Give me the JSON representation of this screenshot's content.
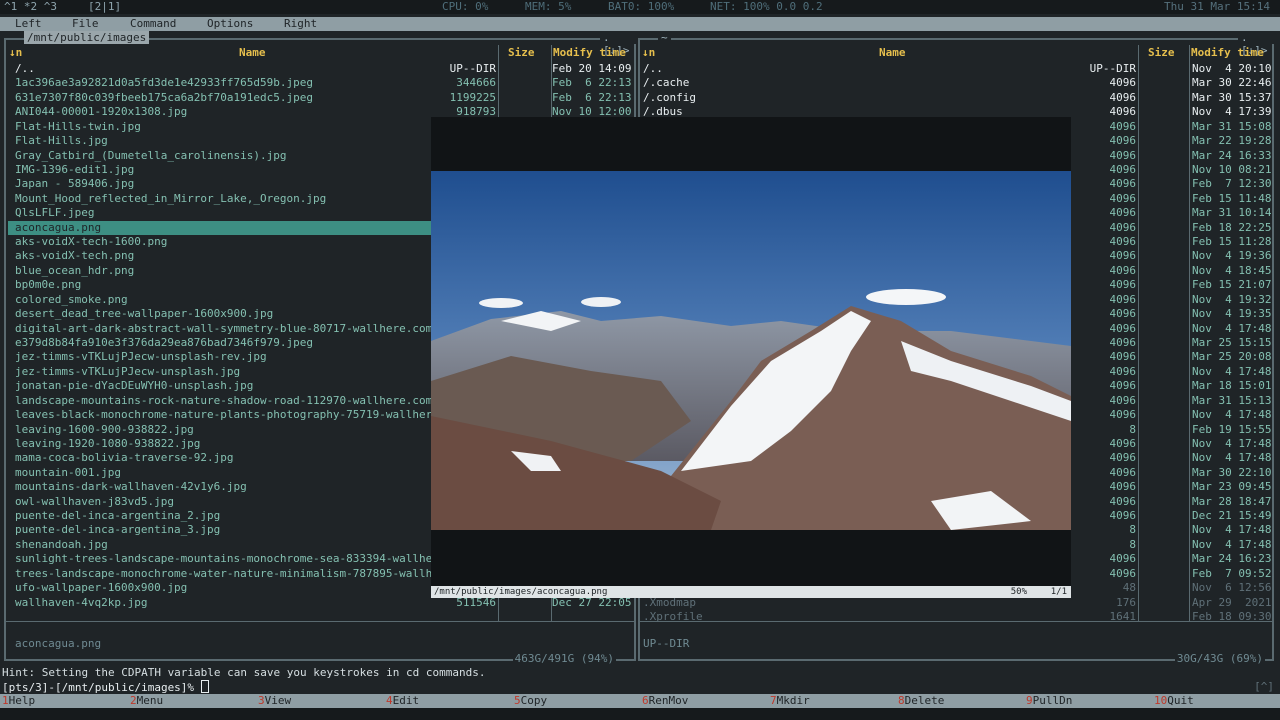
{
  "statusbar": {
    "workspaces": "^1 *2 ^3",
    "layout": "[2|1]",
    "cpu": "CPU:  0%",
    "mem": "MEM:  5%",
    "bat": "BAT0:  100%",
    "net": "NET:  100%  0.0  0.2",
    "clock": "Thu 31 Mar 15:14"
  },
  "menu": [
    "Left",
    "File",
    "Command",
    "Options",
    "Right"
  ],
  "left": {
    "path": "/mnt/public/images",
    "sort_indicator": ".[↓]>",
    "header": {
      "sort": "↓n",
      "name": "Name",
      "size": "Size",
      "mtime": "Modify time"
    },
    "rows": [
      {
        "n": "/..",
        "s": "UP--DIR",
        "t": "Feb 20 14:09",
        "type": "dir"
      },
      {
        "n": "1ac396ae3a92821d0a5fd3de1e42933ff765d59b.jpeg",
        "s": "344666",
        "t": "Feb  6 22:13"
      },
      {
        "n": "631e7307f80c039fbeeb175ca6a2bf70a191edc5.jpeg",
        "s": "1199225",
        "t": "Feb  6 22:13"
      },
      {
        "n": "ANI044-00001-1920x1308.jpg",
        "s": "918793",
        "t": "Nov 10 12:00"
      },
      {
        "n": "Flat-Hills-twin.jpg",
        "s": "",
        "t": ""
      },
      {
        "n": "Flat-Hills.jpg",
        "s": "",
        "t": ""
      },
      {
        "n": "Gray_Catbird_(Dumetella_carolinensis).jpg",
        "s": "",
        "t": ""
      },
      {
        "n": "IMG-1396-edit1.jpg",
        "s": "",
        "t": ""
      },
      {
        "n": "Japan - 589406.jpg",
        "s": "",
        "t": ""
      },
      {
        "n": "Mount_Hood_reflected_in_Mirror_Lake,_Oregon.jpg",
        "s": "",
        "t": ""
      },
      {
        "n": "QlsLFLF.jpeg",
        "s": "",
        "t": ""
      },
      {
        "n": "aconcagua.png",
        "s": "",
        "t": "",
        "selected": true
      },
      {
        "n": "aks-voidX-tech-1600.png",
        "s": "",
        "t": ""
      },
      {
        "n": "aks-voidX-tech.png",
        "s": "",
        "t": ""
      },
      {
        "n": "blue_ocean_hdr.png",
        "s": "",
        "t": ""
      },
      {
        "n": "bp0m0e.png",
        "s": "",
        "t": ""
      },
      {
        "n": "colored_smoke.png",
        "s": "",
        "t": ""
      },
      {
        "n": "desert_dead_tree-wallpaper-1600x900.jpg",
        "s": "",
        "t": ""
      },
      {
        "n": "digital-art-dark-abstract-wall-symmetry-blue-80717-wallhere.com.j",
        "s": "",
        "t": ""
      },
      {
        "n": "e379d8b84fa910e3f376da29ea876bad7346f979.jpeg",
        "s": "",
        "t": ""
      },
      {
        "n": "jez-timms-vTKLujPJecw-unsplash-rev.jpg",
        "s": "",
        "t": ""
      },
      {
        "n": "jez-timms-vTKLujPJecw-unsplash.jpg",
        "s": "",
        "t": ""
      },
      {
        "n": "jonatan-pie-dYacDEuWYH0-unsplash.jpg",
        "s": "",
        "t": ""
      },
      {
        "n": "landscape-mountains-rock-nature-shadow-road-112970-wallhere.com(1",
        "s": "",
        "t": ""
      },
      {
        "n": "leaves-black-monochrome-nature-plants-photography-75719-wallhere.",
        "s": "",
        "t": ""
      },
      {
        "n": "leaving-1600-900-938822.jpg",
        "s": "",
        "t": ""
      },
      {
        "n": "leaving-1920-1080-938822.jpg",
        "s": "",
        "t": ""
      },
      {
        "n": "mama-coca-bolivia-traverse-92.jpg",
        "s": "",
        "t": ""
      },
      {
        "n": "mountain-001.jpg",
        "s": "",
        "t": ""
      },
      {
        "n": "mountains-dark-wallhaven-42v1y6.jpg",
        "s": "",
        "t": ""
      },
      {
        "n": "owl-wallhaven-j83vd5.jpg",
        "s": "",
        "t": ""
      },
      {
        "n": "puente-del-inca-argentina_2.jpg",
        "s": "",
        "t": ""
      },
      {
        "n": "puente-del-inca-argentina_3.jpg",
        "s": "",
        "t": ""
      },
      {
        "n": "shenandoah.jpg",
        "s": "",
        "t": ""
      },
      {
        "n": "sunlight-trees-landscape-mountains-monochrome-sea-833394-wallhere",
        "s": "",
        "t": ""
      },
      {
        "n": "trees-landscape-monochrome-water-nature-minimalism-787895-wallher",
        "s": "",
        "t": ""
      },
      {
        "n": "ufo-wallpaper-1600x900.jpg",
        "s": "",
        "t": ""
      },
      {
        "n": "wallhaven-4vq2kp.jpg",
        "s": "511546",
        "t": "Dec 27 22:05"
      }
    ],
    "mini_status": "aconcagua.png",
    "disk": "463G/491G (94%)"
  },
  "right": {
    "path": "~",
    "sort_indicator": ".[↓]>",
    "header": {
      "sort": "↓n",
      "name": "Name",
      "size": "Size",
      "mtime": "Modify time"
    },
    "rows": [
      {
        "n": "/..",
        "s": "UP--DIR",
        "t": "Nov  4 20:10",
        "type": "dir"
      },
      {
        "n": "/.cache",
        "s": "4096",
        "t": "Mar 30 22:46",
        "type": "dir"
      },
      {
        "n": "/.config",
        "s": "4096",
        "t": "Mar 30 15:37",
        "type": "dir"
      },
      {
        "n": "/.dbus",
        "s": "4096",
        "t": "Nov  4 17:39",
        "type": "dir"
      },
      {
        "n": "",
        "s": "4096",
        "t": "Mar 31 15:08"
      },
      {
        "n": "",
        "s": "4096",
        "t": "Mar 22 19:28"
      },
      {
        "n": "",
        "s": "4096",
        "t": "Mar 24 16:33"
      },
      {
        "n": "",
        "s": "4096",
        "t": "Nov 10 08:21"
      },
      {
        "n": "",
        "s": "4096",
        "t": "Feb  7 12:30"
      },
      {
        "n": "",
        "s": "4096",
        "t": "Feb 15 11:48"
      },
      {
        "n": "",
        "s": "4096",
        "t": "Mar 31 10:14"
      },
      {
        "n": "",
        "s": "4096",
        "t": "Feb 18 22:25"
      },
      {
        "n": "",
        "s": "4096",
        "t": "Feb 15 11:28"
      },
      {
        "n": "",
        "s": "4096",
        "t": "Nov  4 19:36"
      },
      {
        "n": "",
        "s": "4096",
        "t": "Nov  4 18:45"
      },
      {
        "n": "",
        "s": "4096",
        "t": "Feb 15 21:07"
      },
      {
        "n": "",
        "s": "4096",
        "t": "Nov  4 19:32"
      },
      {
        "n": "",
        "s": "4096",
        "t": "Nov  4 19:35"
      },
      {
        "n": "",
        "s": "4096",
        "t": "Nov  4 17:48"
      },
      {
        "n": "",
        "s": "4096",
        "t": "Mar 25 15:15"
      },
      {
        "n": "",
        "s": "4096",
        "t": "Mar 25 20:08"
      },
      {
        "n": "",
        "s": "4096",
        "t": "Nov  4 17:48"
      },
      {
        "n": "",
        "s": "4096",
        "t": "Mar 18 15:01"
      },
      {
        "n": "",
        "s": "4096",
        "t": "Mar 31 15:13"
      },
      {
        "n": "",
        "s": "4096",
        "t": "Nov  4 17:48"
      },
      {
        "n": "",
        "s": "8",
        "t": "Feb 19 15:55"
      },
      {
        "n": "",
        "s": "4096",
        "t": "Nov  4 17:48"
      },
      {
        "n": "",
        "s": "4096",
        "t": "Nov  4 17:48"
      },
      {
        "n": "",
        "s": "4096",
        "t": "Mar 30 22:10"
      },
      {
        "n": "",
        "s": "4096",
        "t": "Mar 23 09:45"
      },
      {
        "n": "",
        "s": "4096",
        "t": "Mar 28 18:47"
      },
      {
        "n": "",
        "s": "4096",
        "t": "Dec 21 15:49"
      },
      {
        "n": "",
        "s": "8",
        "t": "Nov  4 17:48"
      },
      {
        "n": "",
        "s": "8",
        "t": "Nov  4 17:48"
      },
      {
        "n": "",
        "s": "4096",
        "t": "Mar 24 16:23"
      },
      {
        "n": "",
        "s": "4096",
        "t": "Feb  7 09:52"
      },
      {
        "n": "",
        "s": "48",
        "t": "Nov  6 12:56",
        "dim": true
      },
      {
        "n": ".Xmodmap",
        "s": "176",
        "t": "Apr 29  2021",
        "dim": true
      },
      {
        "n": ".Xprofile",
        "s": "1641",
        "t": "Feb 18 09:30",
        "dim": true
      }
    ],
    "mini_status": "UP--DIR",
    "disk": "30G/43G (69%)"
  },
  "preview": {
    "caption": "/mnt/public/images/aconcagua.png",
    "zoom": "50%",
    "counter": "1/1"
  },
  "hint": "Hint: Setting the CDPATH variable can save you keystrokes in cd commands.",
  "prompt": "[pts/3]-[/mnt/public/images]% ",
  "corner": "[^]",
  "fkeys": [
    {
      "n": "1",
      "label": "Help"
    },
    {
      "n": "2",
      "label": "Menu"
    },
    {
      "n": "3",
      "label": "View"
    },
    {
      "n": "4",
      "label": "Edit"
    },
    {
      "n": "5",
      "label": "Copy"
    },
    {
      "n": "6",
      "label": "RenMov"
    },
    {
      "n": "7",
      "label": "Mkdir"
    },
    {
      "n": "8",
      "label": "Delete"
    },
    {
      "n": "9",
      "label": "PullDn"
    },
    {
      "n": "10",
      "label": "Quit"
    }
  ]
}
